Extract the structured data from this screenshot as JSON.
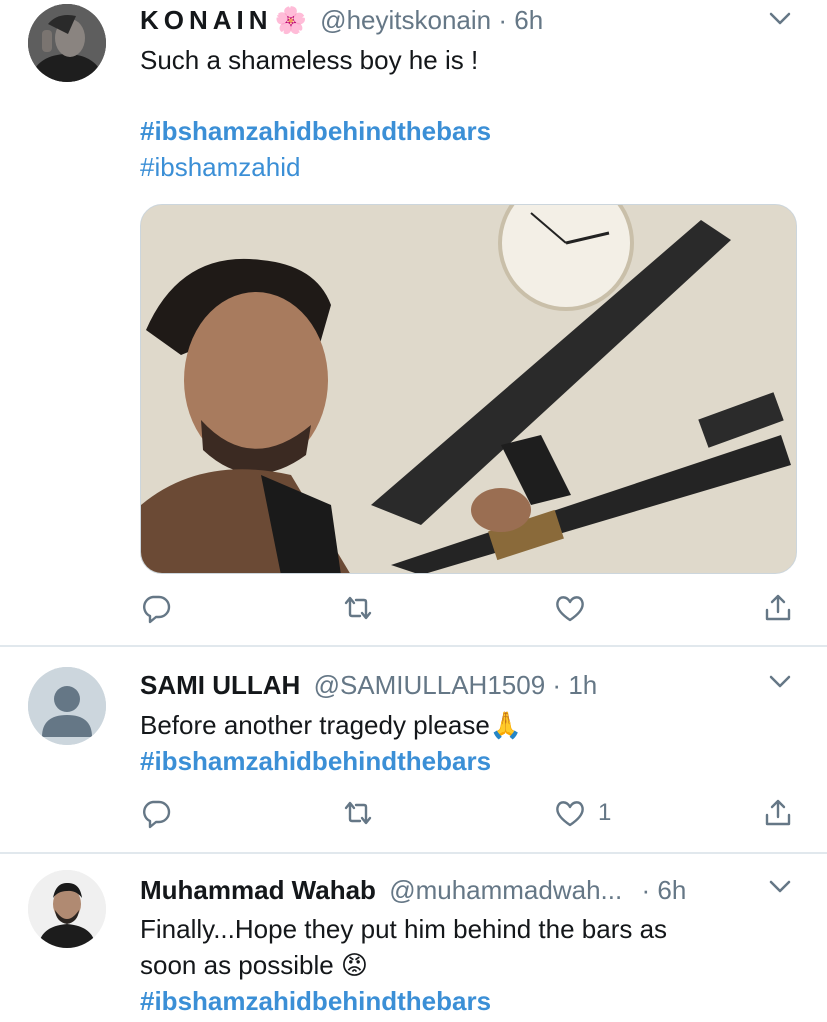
{
  "tweets": [
    {
      "name": "KONAIN",
      "name_emoji": "🌸",
      "handle": "@heyitskonain",
      "separator": "·",
      "time": "6h",
      "lines": [
        "Such a shameless boy he is !"
      ],
      "hashtags": [
        "#ibshamzahidbehindthebars",
        "#ibshamzahid"
      ],
      "has_media": true,
      "like_count": ""
    },
    {
      "name": "SAMI ULLAH",
      "handle": "@SAMIULLAH1509",
      "separator": "·",
      "time": "1h",
      "text": "Before another tragedy please",
      "text_emoji": "🙏",
      "hashtags": [
        "#ibshamzahidbehindthebars"
      ],
      "like_count": "1"
    },
    {
      "name": "Muhammad Wahab",
      "handle": "@muhammadwah...",
      "separator": "·",
      "time": "6h",
      "lines": [
        "Finally...Hope they put him behind the bars as",
        "soon as possible"
      ],
      "text_emoji": "😡",
      "hashtags": [
        "#ibshamzahidbehindthebars"
      ]
    }
  ],
  "icons": {
    "reply": "reply-icon",
    "retweet": "retweet-icon",
    "like": "heart-icon",
    "share": "share-icon",
    "more": "chevron-down-icon"
  },
  "colors": {
    "hashtag": "#3b8fd6",
    "meta": "#657786",
    "divider": "#e1e8ed"
  }
}
